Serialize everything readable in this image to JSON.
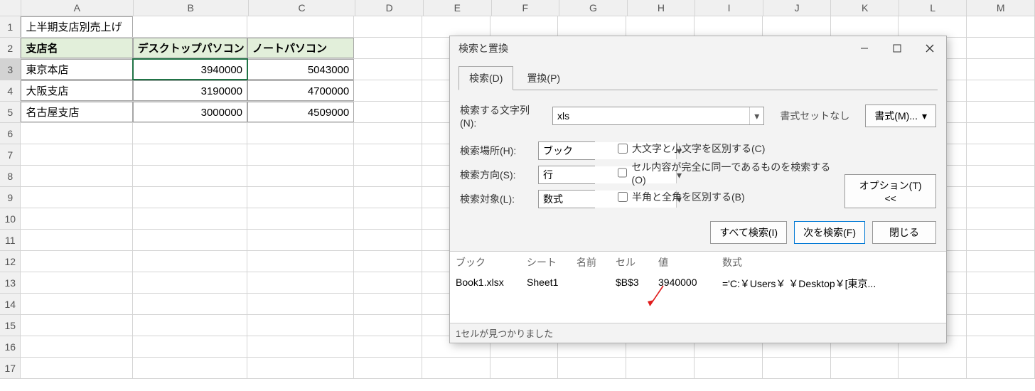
{
  "columns": [
    "A",
    "B",
    "C",
    "D",
    "E",
    "F",
    "G",
    "H",
    "I",
    "J",
    "K",
    "L",
    "M"
  ],
  "rows": [
    "1",
    "2",
    "3",
    "4",
    "5",
    "6",
    "7",
    "8",
    "9",
    "10",
    "11",
    "12",
    "13",
    "14",
    "15",
    "16",
    "17"
  ],
  "sheet": {
    "title": "上半期支店別売上げ",
    "headers": {
      "branch": "支店名",
      "desktop": "デスクトップパソコン",
      "laptop": "ノートパソコン"
    },
    "data": [
      {
        "branch": "東京本店",
        "desktop": "3940000",
        "laptop": "5043000"
      },
      {
        "branch": "大阪支店",
        "desktop": "3190000",
        "laptop": "4700000"
      },
      {
        "branch": "名古屋支店",
        "desktop": "3000000",
        "laptop": "4509000"
      }
    ]
  },
  "dialog": {
    "title": "検索と置換",
    "tabs": {
      "find": "検索(D)",
      "replace": "置換(P)"
    },
    "labels": {
      "find_what": "検索する文字列(N):",
      "within": "検索場所(H):",
      "search": "検索方向(S):",
      "lookin": "検索対象(L):"
    },
    "find_value": "xls",
    "format_none": "書式セットなし",
    "format_btn": "書式(M)...",
    "within_value": "ブック",
    "search_value": "行",
    "lookin_value": "数式",
    "checks": {
      "case": "大文字と小文字を区別する(C)",
      "entire": "セル内容が完全に同一であるものを検索する(O)",
      "byte": "半角と全角を区別する(B)"
    },
    "options_btn": "オプション(T) <<",
    "find_all": "すべて検索(I)",
    "find_next": "次を検索(F)",
    "close": "閉じる",
    "result_headers": {
      "book": "ブック",
      "sheet": "シート",
      "name": "名前",
      "cell": "セル",
      "value": "値",
      "formula": "数式"
    },
    "result": {
      "book": "Book1.xlsx",
      "sheet": "Sheet1",
      "name": "",
      "cell": "$B$3",
      "value": "3940000",
      "formula": "='C:￥Users￥      ￥Desktop￥[東京..."
    },
    "status": "1セルが見つかりました"
  }
}
